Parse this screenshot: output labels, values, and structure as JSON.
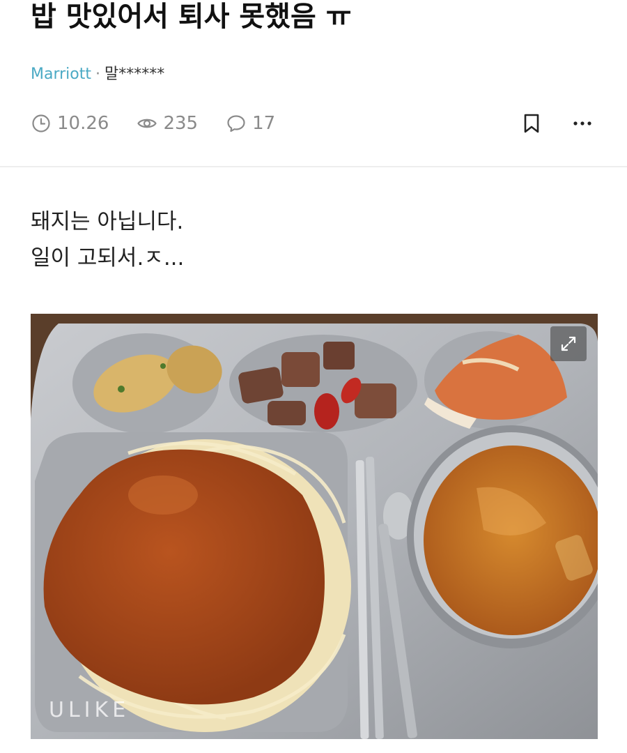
{
  "post": {
    "title": "밥 맛있어서 퇴사 못했음 ㅠ",
    "company": "Marriott",
    "separator": "·",
    "author": "말******",
    "date": "10.26",
    "views": "235",
    "comments": "17",
    "body_lines": [
      "돼지는 아닙니다.",
      "일이 고되서.ㅈ..."
    ]
  },
  "photo": {
    "watermark": "ULIKE"
  },
  "icons": {
    "clock": "clock-icon",
    "views": "eye-icon",
    "comments": "comment-icon",
    "bookmark": "bookmark-icon",
    "more": "more-icon",
    "expand": "expand-icon"
  },
  "colors": {
    "company_link": "#4aa9c4",
    "meta_text": "#8a8a8a"
  }
}
